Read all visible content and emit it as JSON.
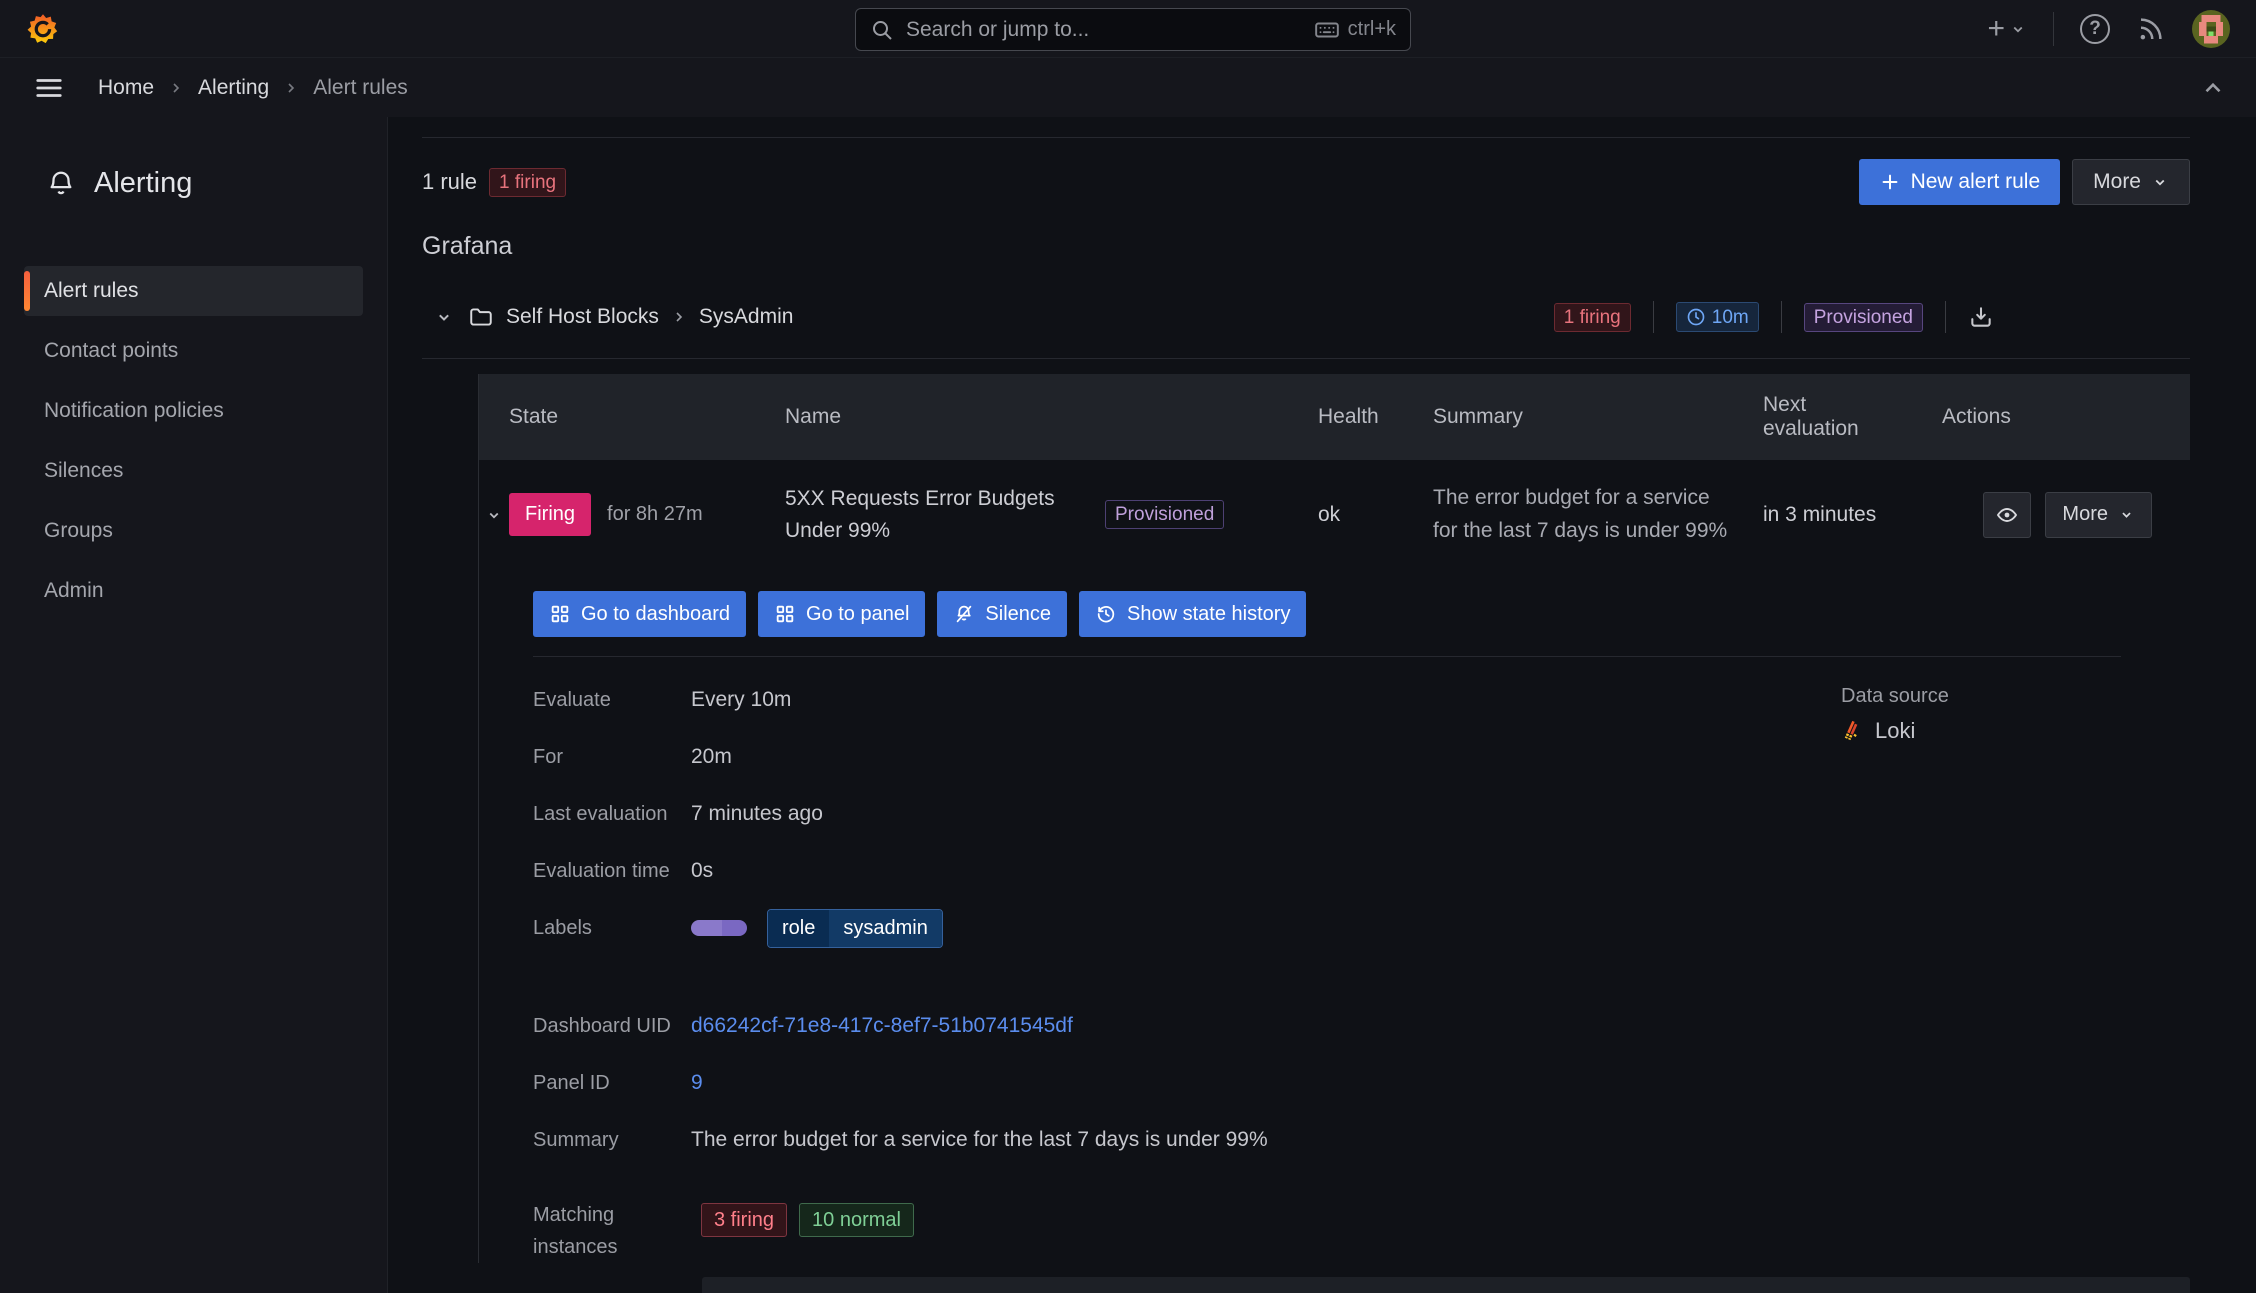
{
  "topbar": {
    "search_placeholder": "Search or jump to...",
    "shortcut": "ctrl+k"
  },
  "icons": {
    "plus": "+",
    "help": "?"
  },
  "breadcrumb": {
    "items": [
      "Home",
      "Alerting",
      "Alert rules"
    ]
  },
  "sidebar": {
    "title": "Alerting",
    "items": [
      {
        "label": "Alert rules",
        "active": true
      },
      {
        "label": "Contact points"
      },
      {
        "label": "Notification policies"
      },
      {
        "label": "Silences"
      },
      {
        "label": "Groups"
      },
      {
        "label": "Admin"
      }
    ]
  },
  "header": {
    "rule_count": "1 rule",
    "firing_badge": "1 firing",
    "new_alert_rule": "New alert rule",
    "more": "More"
  },
  "group": {
    "section_title": "Grafana",
    "folder": "Self Host Blocks",
    "subfolder": "SysAdmin",
    "firing_badge": "1 firing",
    "interval": "10m",
    "provisioned": "Provisioned"
  },
  "table": {
    "headers": [
      "State",
      "Name",
      "Health",
      "Summary",
      "Next evaluation",
      "Actions"
    ],
    "row": {
      "state": "Firing",
      "for": "for 8h 27m",
      "name": "5XX Requests Error Budgets Under 99%",
      "provisioned": "Provisioned",
      "health": "ok",
      "summary": "The error budget for a service for the last 7 days is under 99%",
      "next_evaluation": "in 3 minutes",
      "more": "More"
    }
  },
  "actions": {
    "go_to_dashboard": "Go to dashboard",
    "go_to_panel": "Go to panel",
    "silence": "Silence",
    "show_state_history": "Show state history"
  },
  "details": {
    "rows": [
      {
        "label": "Evaluate",
        "value": "Every 10m"
      },
      {
        "label": "For",
        "value": "20m"
      },
      {
        "label": "Last evaluation",
        "value": "7 minutes ago"
      },
      {
        "label": "Evaluation time",
        "value": "0s"
      }
    ],
    "labels_label": "Labels",
    "label_badge": {
      "key": "role",
      "value": "sysadmin"
    },
    "datasource_label": "Data source",
    "datasource_name": "Loki",
    "dashboard_uid_label": "Dashboard UID",
    "dashboard_uid": "d66242cf-71e8-417c-8ef7-51b0741545df",
    "panel_id_label": "Panel ID",
    "panel_id": "9",
    "summary_label": "Summary",
    "summary": "The error budget for a service for the last 7 days is under 99%",
    "matching_label": "Matching instances",
    "matching_firing": "3 firing",
    "matching_normal": "10 normal"
  },
  "colors": {
    "primary_blue": "#3d71d9",
    "firing_pink": "#d6246c",
    "firing_badge_text": "#e8737d",
    "normal_green": "#7fcf96",
    "provisioned_purple": "#c5a3e0",
    "interval_blue": "#6ea6f5",
    "link_blue": "#5b8dee",
    "accent_orange": "#ff8833",
    "background": "#0f1116",
    "chrome_background": "#15161c",
    "table_header_background": "#202329"
  }
}
